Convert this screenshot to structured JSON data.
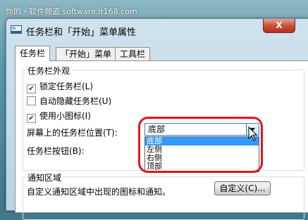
{
  "watermark": "你的・软件频道 software.it168.com",
  "window": {
    "title": "任务栏和「开始」菜单属性",
    "close_label": "X"
  },
  "tabs": [
    {
      "label": "任务栏"
    },
    {
      "label": "「开始」菜单"
    },
    {
      "label": "工具栏"
    }
  ],
  "appearance": {
    "group_label": "任务栏外观",
    "options": [
      {
        "label": "锁定任务栏(L)",
        "checked": true
      },
      {
        "label": "自动隐藏任务栏(U)",
        "checked": false
      },
      {
        "label": "使用小图标(I)",
        "checked": true
      }
    ],
    "position_label": "屏幕上的任务栏位置(T):",
    "position_value": "底部",
    "position_options": [
      "底部",
      "左侧",
      "右侧",
      "顶部"
    ],
    "buttons_label": "任务栏按钮(B):"
  },
  "notification": {
    "group_label": "通知区域",
    "description": "自定义通知区域中出现的图标和通知。",
    "customize_button": "自定义(C)..."
  },
  "colors": {
    "selection": "#3399ff",
    "highlight": "#e0141e"
  }
}
